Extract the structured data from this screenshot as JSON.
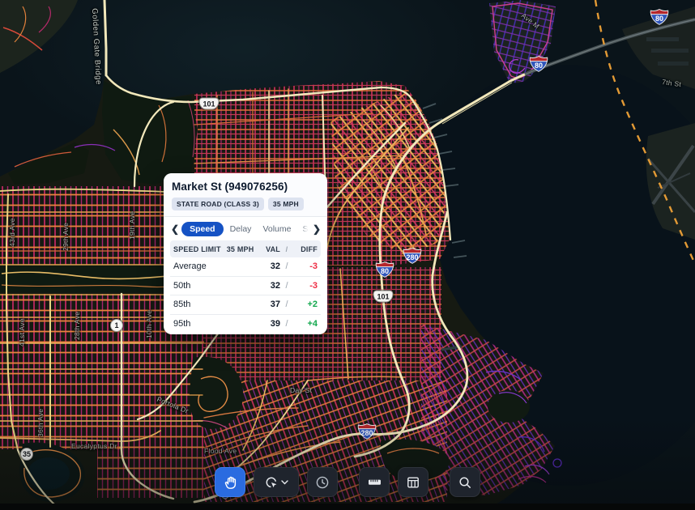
{
  "popup": {
    "title": "Market St (949076256)",
    "badges": [
      "STATE ROAD (CLASS 3)",
      "35 MPH"
    ],
    "tabs": [
      {
        "label": "Speed",
        "active": true
      },
      {
        "label": "Delay",
        "active": false
      },
      {
        "label": "Volume",
        "active": false
      },
      {
        "label": "Safety",
        "active": false
      }
    ],
    "nav": {
      "prev": "❮",
      "next": "❯"
    },
    "table": {
      "header": {
        "label": "SPEED LIMIT",
        "limit": "35 MPH",
        "val": "VAL",
        "sep": "/",
        "diff": "DIFF"
      },
      "rows": [
        {
          "label": "Average",
          "val": "32",
          "sep": "/",
          "diff": "-3",
          "trend": "down"
        },
        {
          "label": "50th",
          "val": "32",
          "sep": "/",
          "diff": "-3",
          "trend": "down"
        },
        {
          "label": "85th",
          "val": "37",
          "sep": "/",
          "diff": "+2",
          "trend": "up"
        },
        {
          "label": "95th",
          "val": "39",
          "sep": "/",
          "diff": "+4",
          "trend": "up"
        }
      ]
    },
    "colors": {
      "accent": "#1552c4",
      "diff_down": "#ee2d44",
      "diff_up": "#13a84e"
    }
  },
  "toolbar": {
    "buttons": [
      {
        "id": "pan",
        "active": true
      },
      {
        "id": "select",
        "active": false,
        "has_dropdown": true
      },
      {
        "id": "time",
        "active": false
      },
      {
        "id": "measure",
        "active": false
      },
      {
        "id": "table",
        "active": false
      },
      {
        "id": "search",
        "active": false
      }
    ]
  },
  "map": {
    "labels": [
      {
        "text": "Golden Gate Bridge"
      },
      {
        "text": "Ave M"
      },
      {
        "text": "7th St"
      },
      {
        "text": "43rd Ave"
      },
      {
        "text": "29th Ave"
      },
      {
        "text": "19th Ave"
      },
      {
        "text": "41st Ave"
      },
      {
        "text": "28th Ave"
      },
      {
        "text": "10th Ave"
      },
      {
        "text": "36th Ave"
      },
      {
        "text": "Eucalyptus Dr"
      },
      {
        "text": "Portola Dr"
      },
      {
        "text": "Day St"
      },
      {
        "text": "Flood Ave"
      }
    ],
    "shields": [
      {
        "type": "us",
        "label": "101"
      },
      {
        "type": "interstate",
        "label": "280"
      },
      {
        "type": "interstate",
        "label": "80"
      },
      {
        "type": "us",
        "label": "101"
      },
      {
        "type": "interstate",
        "label": "80"
      },
      {
        "type": "interstate",
        "label": "80"
      },
      {
        "type": "interstate",
        "label": "280"
      },
      {
        "type": "interstate",
        "label": "280"
      },
      {
        "type": "state",
        "label": "1"
      },
      {
        "type": "state",
        "label": "35"
      }
    ],
    "colors": {
      "water": "#0a141a",
      "land": "#161a12",
      "park": "#0f1a11",
      "road_fast": "#f2e8bb",
      "road_mid": "#e8823e",
      "road_slow": "#c62865",
      "road_slowest": "#5b2bbf",
      "boundary": "#e39a35"
    }
  }
}
